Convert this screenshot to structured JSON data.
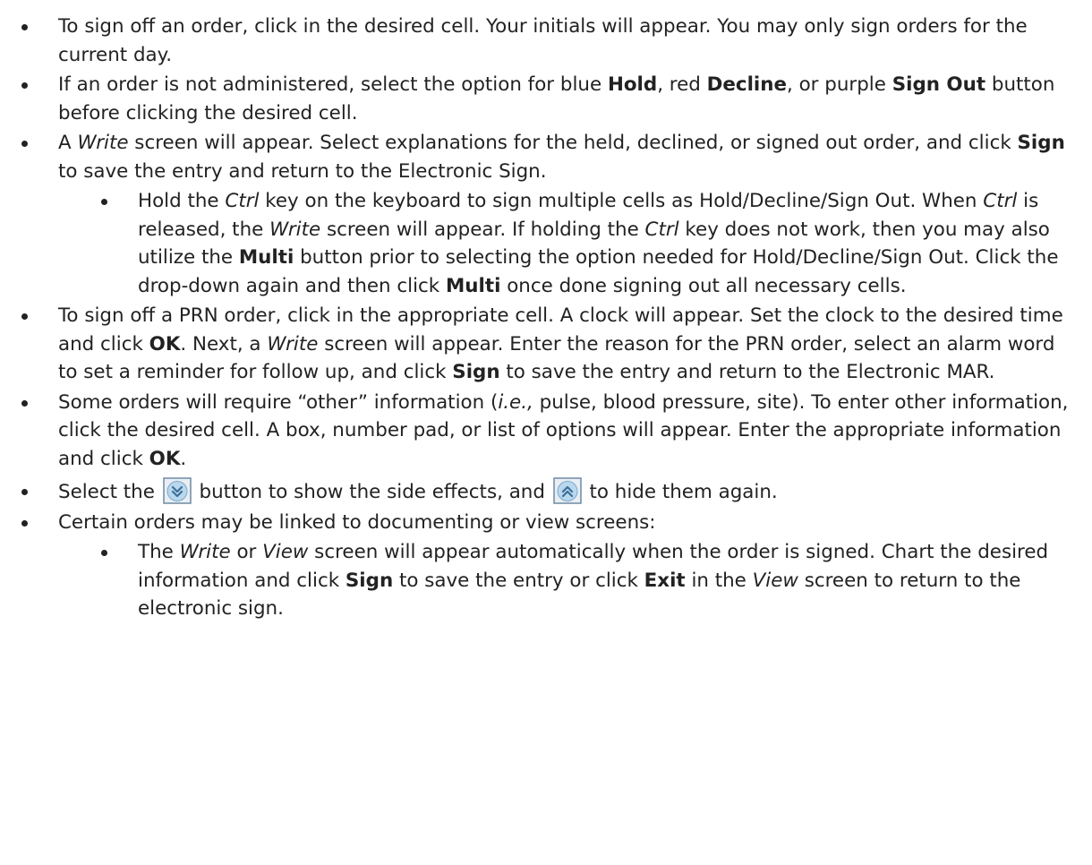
{
  "bullets": [
    {
      "level": 1,
      "parts": [
        {
          "t": "To sign off an order, click in the desired cell. Your initials will appear. You may only sign orders for the current day.",
          "s": "n"
        }
      ]
    },
    {
      "level": 1,
      "parts": [
        {
          "t": "If an order is not administered, select the option for blue ",
          "s": "n"
        },
        {
          "t": "Hold",
          "s": "b"
        },
        {
          "t": ", red ",
          "s": "n"
        },
        {
          "t": "Decline",
          "s": "b"
        },
        {
          "t": ", or purple ",
          "s": "n"
        },
        {
          "t": "Sign Out",
          "s": "b"
        },
        {
          "t": " button before clicking the desired cell.",
          "s": "n"
        }
      ]
    },
    {
      "level": 1,
      "parts": [
        {
          "t": "A ",
          "s": "n"
        },
        {
          "t": "Write",
          "s": "i"
        },
        {
          "t": " screen will appear. Select explanations for the held, declined, or signed out order, and click ",
          "s": "n"
        },
        {
          "t": "Sign",
          "s": "b"
        },
        {
          "t": " to save the entry and return to the Electronic Sign.",
          "s": "n"
        }
      ]
    },
    {
      "level": 2,
      "parts": [
        {
          "t": "Hold the ",
          "s": "n"
        },
        {
          "t": "Ctrl",
          "s": "i"
        },
        {
          "t": " key on the keyboard to sign multiple cells as Hold/Decline/Sign Out. When ",
          "s": "n"
        },
        {
          "t": "Ctrl",
          "s": "i"
        },
        {
          "t": " is released, the ",
          "s": "n"
        },
        {
          "t": "Write",
          "s": "i"
        },
        {
          "t": " screen will appear. If holding the ",
          "s": "n"
        },
        {
          "t": "Ctrl",
          "s": "i"
        },
        {
          "t": " key does not work, then you may also utilize the ",
          "s": "n"
        },
        {
          "t": "Multi",
          "s": "b"
        },
        {
          "t": " button prior to selecting the option needed for Hold/Decline/Sign Out.  Click the drop-down again and then click ",
          "s": "n"
        },
        {
          "t": "Multi",
          "s": "b"
        },
        {
          "t": " once done signing out all necessary cells.",
          "s": "n"
        }
      ]
    },
    {
      "level": 1,
      "parts": [
        {
          "t": "To sign off a PRN order, click in the appropriate cell. A clock will appear. Set the clock to the desired time and click ",
          "s": "n"
        },
        {
          "t": "OK",
          "s": "b"
        },
        {
          "t": ". Next, a ",
          "s": "n"
        },
        {
          "t": "Write",
          "s": "i"
        },
        {
          "t": " screen will appear. Enter the reason for the PRN order, select an alarm word to set a reminder for follow up, and click ",
          "s": "n"
        },
        {
          "t": "Sign",
          "s": "b"
        },
        {
          "t": " to save the entry and return to the Electronic MAR.",
          "s": "n"
        }
      ]
    },
    {
      "level": 1,
      "parts": [
        {
          "t": "Some orders will require “other” information (",
          "s": "n"
        },
        {
          "t": "i.e.,",
          "s": "i"
        },
        {
          "t": " pulse, blood pressure, site). To enter other information, click the desired cell. A box, number pad, or list of options will appear. Enter the appropriate information and click ",
          "s": "n"
        },
        {
          "t": "OK",
          "s": "b"
        },
        {
          "t": ".",
          "s": "n"
        }
      ]
    },
    {
      "level": 1,
      "gap": true,
      "parts": [
        {
          "t": "Select the ",
          "s": "n"
        },
        {
          "icon": "expand-down-button-icon"
        },
        {
          "t": " button to show the side effects, and ",
          "s": "n"
        },
        {
          "icon": "collapse-up-button-icon"
        },
        {
          "t": " to hide them again.",
          "s": "n"
        }
      ]
    },
    {
      "level": 1,
      "parts": [
        {
          "t": "Certain orders may be linked to documenting or view screens:",
          "s": "n"
        }
      ]
    },
    {
      "level": 2,
      "parts": [
        {
          "t": "The ",
          "s": "n"
        },
        {
          "t": "Write",
          "s": "i"
        },
        {
          "t": " or ",
          "s": "n"
        },
        {
          "t": "View",
          "s": "i"
        },
        {
          "t": " screen will appear automatically when the order is signed. Chart the desired information and click ",
          "s": "n"
        },
        {
          "t": "Sign",
          "s": "b"
        },
        {
          "t": " to save the entry or click ",
          "s": "n"
        },
        {
          "t": "Exit",
          "s": "b"
        },
        {
          "t": " in the ",
          "s": "n"
        },
        {
          "t": "View",
          "s": "i"
        },
        {
          "t": " screen to return to the electronic sign.",
          "s": "n"
        }
      ]
    }
  ],
  "colors": {
    "text": "#222222",
    "icon_fill": "#b9d8ee",
    "icon_border": "#6f8aa3",
    "icon_bg": "#e8eef4"
  }
}
